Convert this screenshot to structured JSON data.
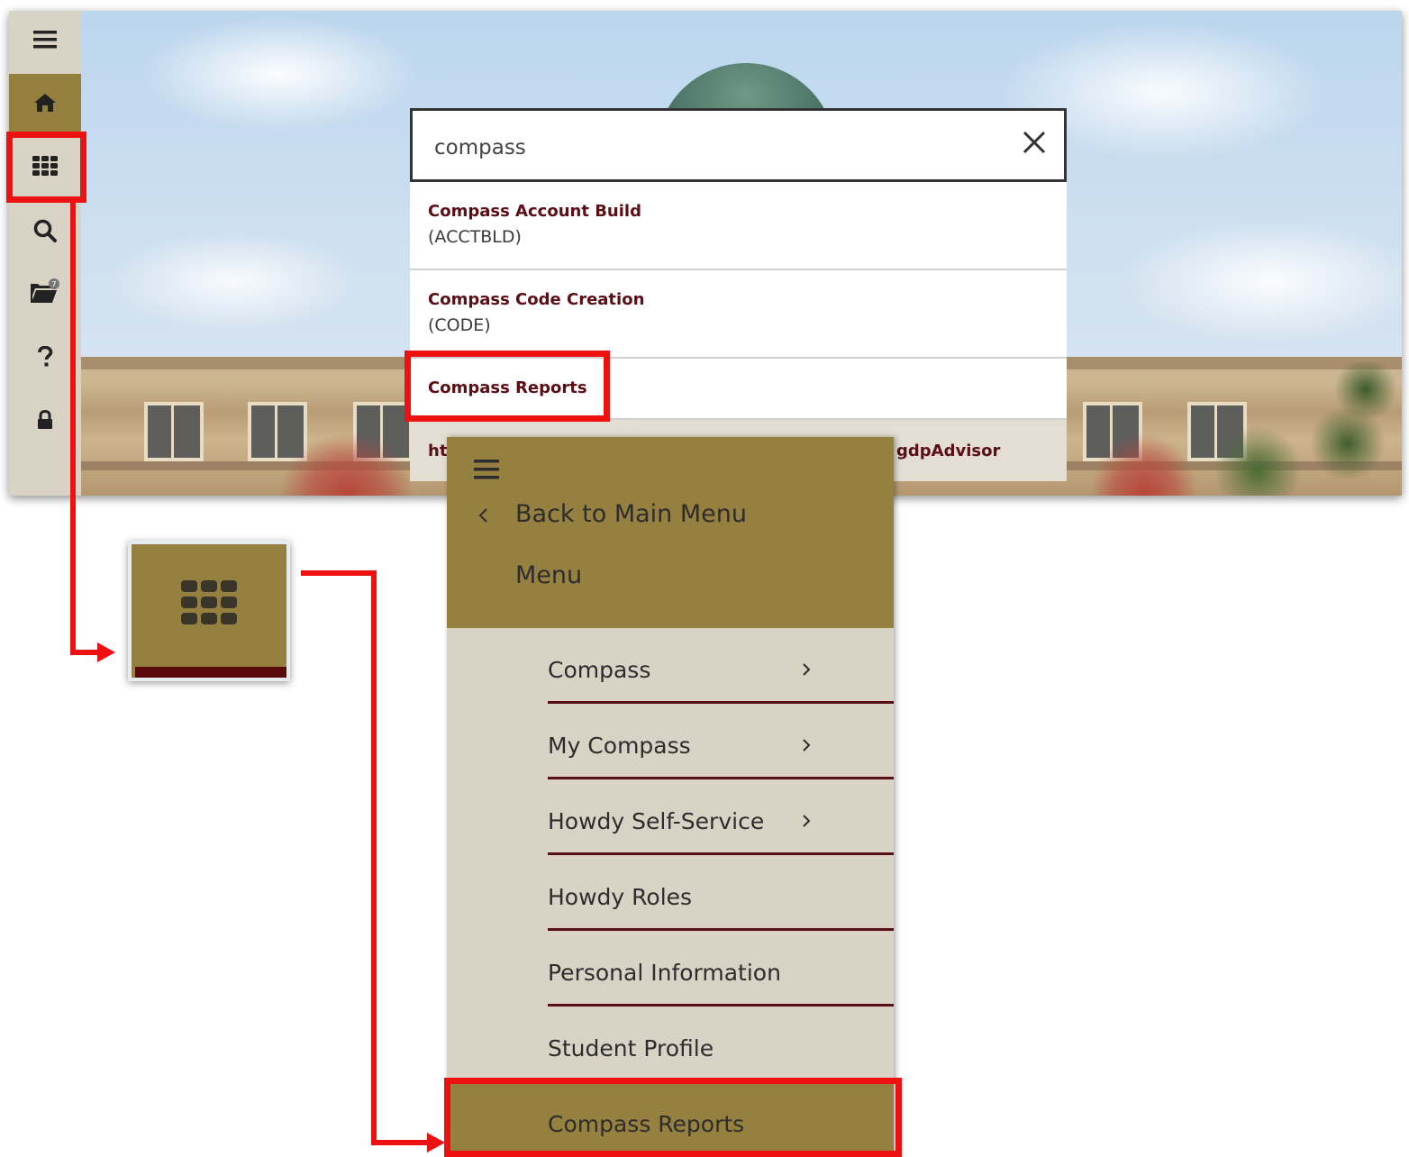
{
  "toolbar": {
    "items": [
      {
        "name": "menu",
        "icon": "hamburger-icon"
      },
      {
        "name": "home",
        "icon": "home-icon"
      },
      {
        "name": "applications",
        "icon": "grid-icon"
      },
      {
        "name": "search",
        "icon": "search-icon"
      },
      {
        "name": "documents",
        "icon": "folder-icon",
        "badge": "7"
      },
      {
        "name": "help",
        "icon": "question-icon"
      },
      {
        "name": "sign-out",
        "icon": "lock-icon"
      }
    ]
  },
  "search": {
    "value": "compass",
    "results": [
      {
        "title": "Compass Account Build",
        "code": "(ACCTBLD)"
      },
      {
        "title": "Compass Code Creation",
        "code": "(CODE)"
      },
      {
        "title": "Compass Reports",
        "code": ""
      }
    ],
    "partial_left": "ht",
    "partial_right": "gdpAdvisor"
  },
  "menu": {
    "back_label": "Back to Main Menu",
    "title": "Menu",
    "items": [
      {
        "label": "Compass",
        "has_submenu": true
      },
      {
        "label": "My Compass",
        "has_submenu": true
      },
      {
        "label": "Howdy Self-Service",
        "has_submenu": true
      },
      {
        "label": "Howdy Roles",
        "has_submenu": false
      },
      {
        "label": "Personal Information",
        "has_submenu": false
      },
      {
        "label": "Student Profile",
        "has_submenu": false
      },
      {
        "label": "Compass Reports",
        "has_submenu": false
      }
    ]
  },
  "colors": {
    "accent_gold": "#95803f",
    "maroon": "#5a0f16",
    "panel_gray": "#d8d3c5",
    "highlight_red": "#ee1111"
  }
}
